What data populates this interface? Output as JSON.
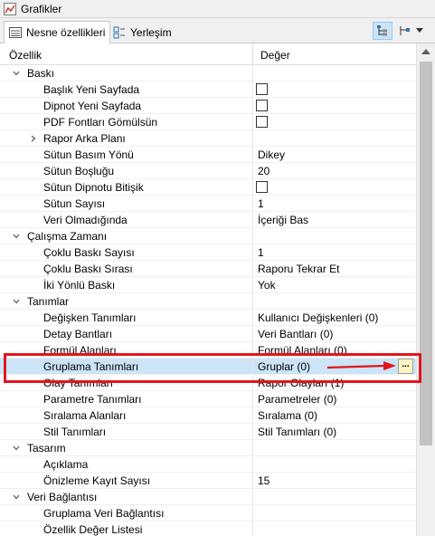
{
  "window": {
    "title": "Grafikler"
  },
  "tabs": [
    {
      "label": "Nesne özellikleri",
      "active": true
    },
    {
      "label": "Yerleşim",
      "active": false
    }
  ],
  "columns": {
    "property": "Özellik",
    "value": "Değer"
  },
  "rows": [
    {
      "type": "category",
      "name": "Baskı",
      "expanded": true
    },
    {
      "type": "prop",
      "name": "Başlık Yeni Sayfada",
      "checkbox": true
    },
    {
      "type": "prop",
      "name": "Dipnot Yeni Sayfada",
      "checkbox": true
    },
    {
      "type": "prop",
      "name": "PDF Fontları Gömülsün",
      "checkbox": true
    },
    {
      "type": "subcategory",
      "name": "Rapor Arka Planı",
      "expanded": false
    },
    {
      "type": "prop",
      "name": "Sütun Basım Yönü",
      "value": "Dikey"
    },
    {
      "type": "prop",
      "name": "Sütun Boşluğu",
      "value": "20"
    },
    {
      "type": "prop",
      "name": "Sütun Dipnotu Bitişik",
      "checkbox": true
    },
    {
      "type": "prop",
      "name": "Sütun Sayısı",
      "value": "1"
    },
    {
      "type": "prop",
      "name": "Veri Olmadığında",
      "value": "İçeriği Bas"
    },
    {
      "type": "category",
      "name": "Çalışma Zamanı",
      "expanded": true
    },
    {
      "type": "prop",
      "name": "Çoklu Baskı Sayısı",
      "value": "1"
    },
    {
      "type": "prop",
      "name": "Çoklu Baskı Sırası",
      "value": "Raporu Tekrar Et"
    },
    {
      "type": "prop",
      "name": "İki Yönlü Baskı",
      "value": "Yok"
    },
    {
      "type": "category",
      "name": "Tanımlar",
      "expanded": true
    },
    {
      "type": "prop",
      "name": "Değişken Tanımları",
      "value": "Kullanıcı Değişkenleri (0)"
    },
    {
      "type": "prop",
      "name": "Detay Bantları",
      "value": "Veri Bantları (0)"
    },
    {
      "type": "prop",
      "name": "Formül Alanları",
      "value": "Formül Alanları (0)"
    },
    {
      "type": "prop",
      "name": "Gruplama Tanımları",
      "value": "Gruplar (0)",
      "selected": true,
      "ellipsis": "..."
    },
    {
      "type": "prop",
      "name": "Olay Tanımları",
      "value": "Rapor Olayları (1)"
    },
    {
      "type": "prop",
      "name": "Parametre Tanımları",
      "value": "Parametreler (0)"
    },
    {
      "type": "prop",
      "name": "Sıralama Alanları",
      "value": "Sıralama (0)"
    },
    {
      "type": "prop",
      "name": "Stil Tanımları",
      "value": "Stil Tanımları (0)"
    },
    {
      "type": "category",
      "name": "Tasarım",
      "expanded": true
    },
    {
      "type": "prop",
      "name": "Açıklama",
      "value": ""
    },
    {
      "type": "prop",
      "name": "Önizleme Kayıt Sayısı",
      "value": "15"
    },
    {
      "type": "category",
      "name": "Veri Bağlantısı",
      "expanded": true
    },
    {
      "type": "prop",
      "name": "Gruplama Veri Bağlantısı",
      "value": ""
    },
    {
      "type": "prop",
      "name": "Özellik Değer Listesi",
      "value": ""
    }
  ],
  "colors": {
    "highlight": "#e0161d",
    "selected_row": "#cce4f7"
  }
}
